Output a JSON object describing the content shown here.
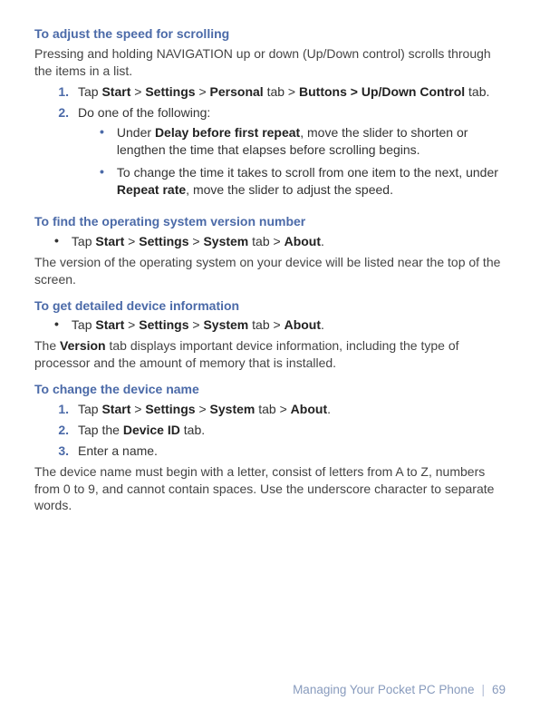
{
  "section1": {
    "heading": "To adjust the speed for scrolling",
    "intro": "Pressing and holding NAVIGATION up or down (Up/Down control) scrolls through the items in a list.",
    "items": [
      {
        "num": "1.",
        "pre": "Tap ",
        "b1": "Start",
        "sep1": " > ",
        "b2": "Settings",
        "sep2": " > ",
        "b3": "Personal",
        "post3": " tab > ",
        "b4": "Buttons > Up/Down Control",
        "post": " tab."
      },
      {
        "num": "2.",
        "text": "Do one of the following:",
        "sub": [
          {
            "pre": "Under ",
            "b1": "Delay before first repeat",
            "post": ", move the slider to shorten or lengthen the time that elapses before scrolling begins."
          },
          {
            "pre": "To change the time it takes to scroll from one item to the next, under ",
            "b1": "Repeat rate",
            "post": ", move the slider to adjust the speed."
          }
        ]
      }
    ]
  },
  "section2": {
    "heading": "To find the operating system version number",
    "bullet": {
      "pre": "Tap ",
      "b1": "Start",
      "s1": " > ",
      "b2": "Settings",
      "s2": " > ",
      "b3": "System",
      "p3": " tab > ",
      "b4": "About",
      "post": "."
    },
    "outro": "The version of the operating system on your device will be listed near the top of the screen."
  },
  "section3": {
    "heading": "To get detailed device information",
    "bullet": {
      "pre": "Tap ",
      "b1": "Start",
      "s1": " > ",
      "b2": "Settings",
      "s2": " > ",
      "b3": "System",
      "p3": " tab > ",
      "b4": "About",
      "post": "."
    },
    "outroPre": "The ",
    "outroB": "Version",
    "outroPost": " tab displays important device information, including the type of processor and the amount of memory that is installed."
  },
  "section4": {
    "heading": "To change the device name",
    "items": [
      {
        "num": "1.",
        "pre": "Tap ",
        "b1": "Start",
        "s1": " > ",
        "b2": "Settings",
        "s2": " > ",
        "b3": "System",
        "p3": " tab > ",
        "b4": "About",
        "post": "."
      },
      {
        "num": "2.",
        "pre": "Tap the ",
        "b1": "Device ID",
        "post": " tab."
      },
      {
        "num": "3.",
        "text": "Enter a name."
      }
    ],
    "outro": "The device name must begin with a letter, consist of letters from A to Z, numbers from 0 to 9, and cannot contain spaces. Use the underscore character to separate words."
  },
  "footer": {
    "title": "Managing Your Pocket PC Phone",
    "page": "69"
  }
}
